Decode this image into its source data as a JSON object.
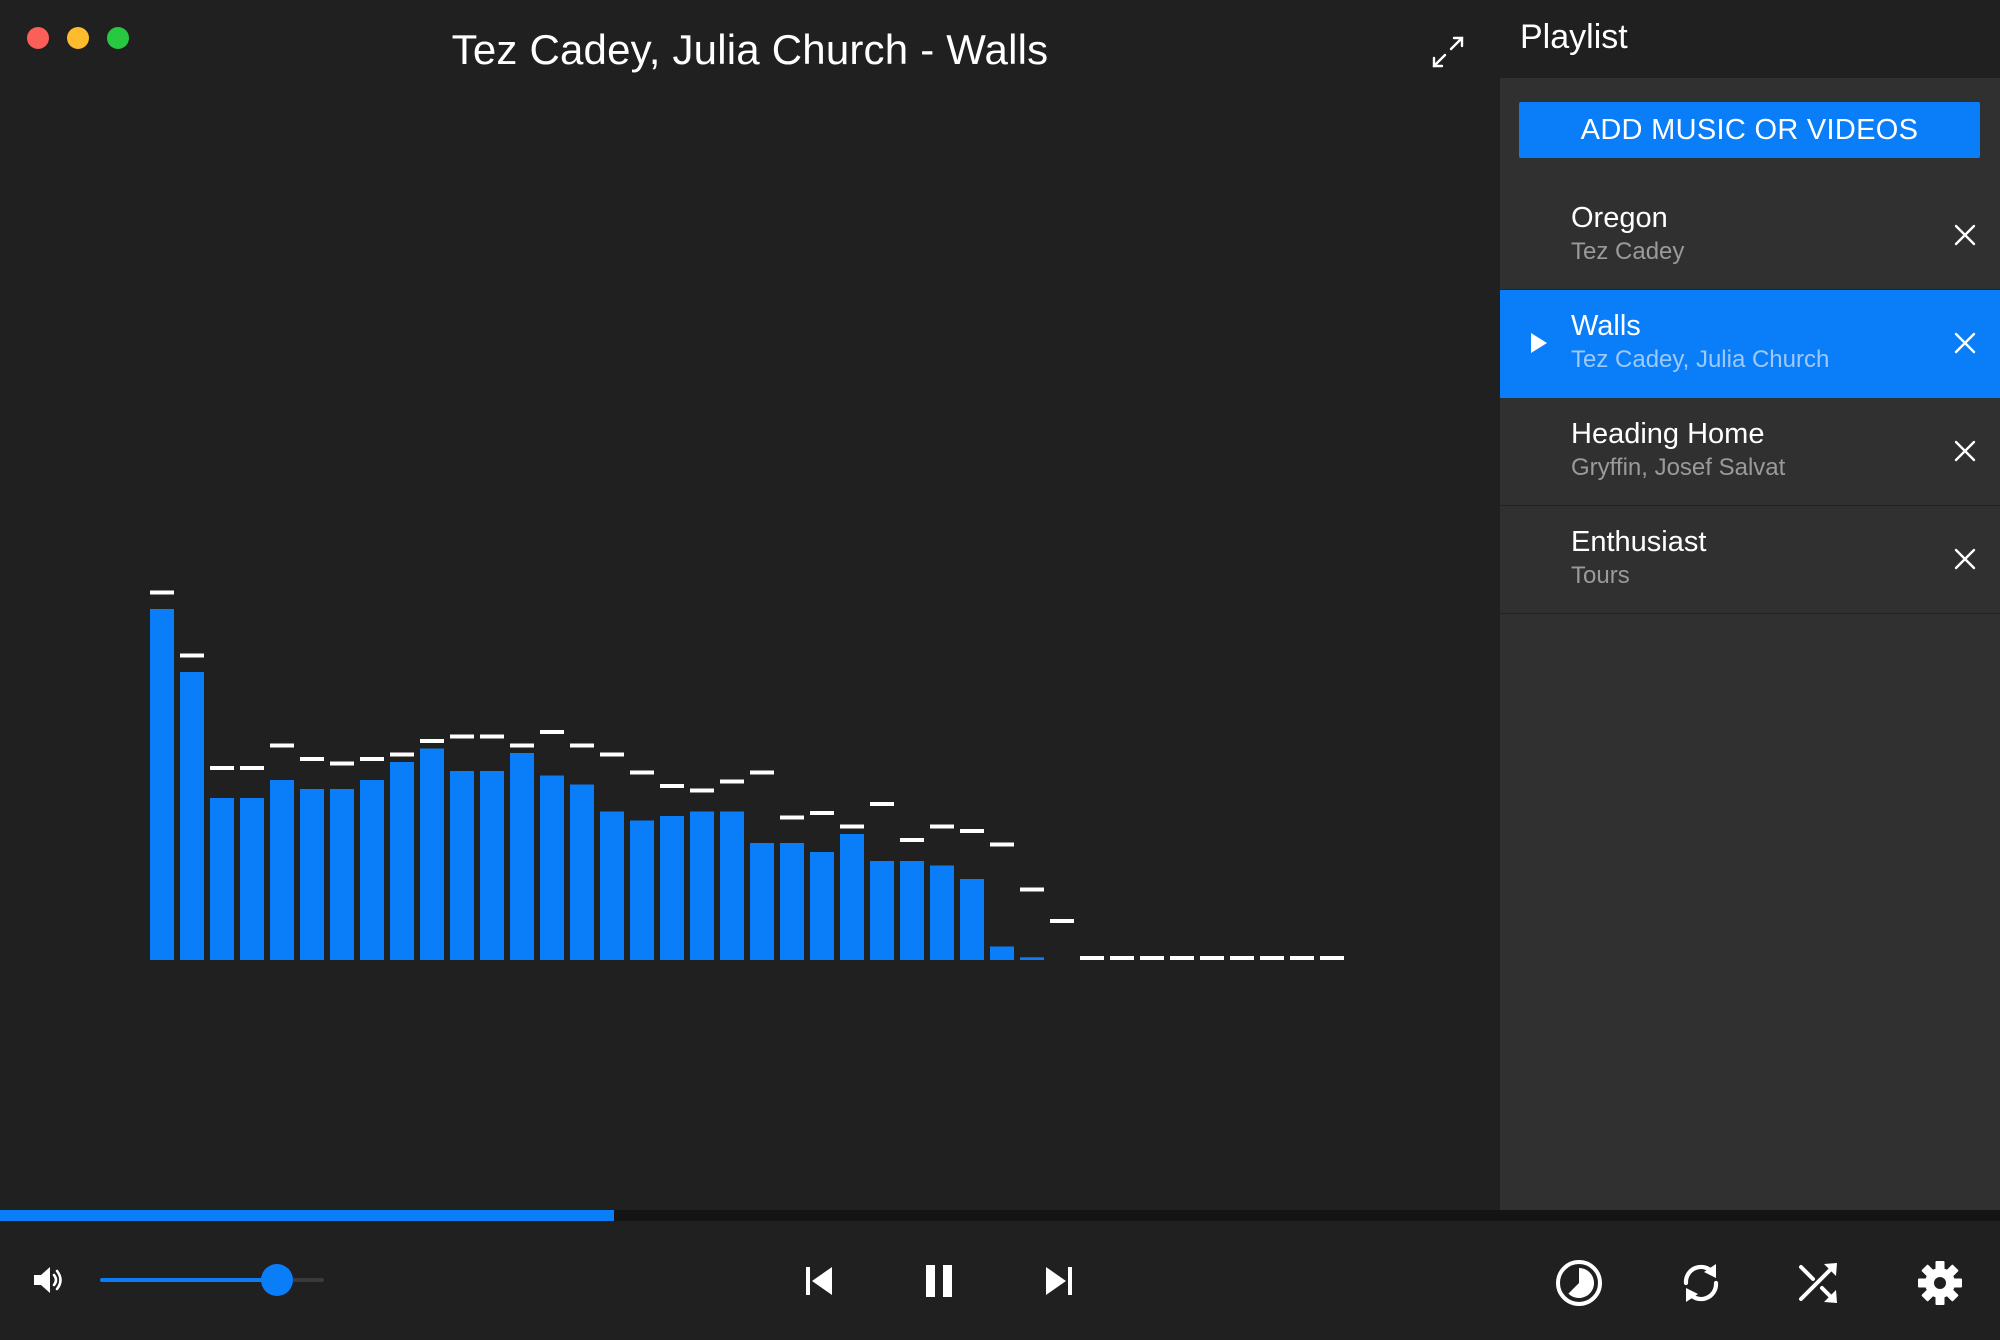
{
  "window": {
    "title": "Tez Cadey, Julia Church - Walls"
  },
  "playlist": {
    "title": "Playlist",
    "add_button_label": "ADD MUSIC OR VIDEOS",
    "items": [
      {
        "song": "Oregon",
        "artist": "Tez Cadey",
        "playing": false
      },
      {
        "song": "Walls",
        "artist": "Tez Cadey, Julia Church",
        "playing": true
      },
      {
        "song": "Heading Home",
        "artist": "Gryffin, Josef Salvat",
        "playing": false
      },
      {
        "song": "Enthusiast",
        "artist": "Tours",
        "playing": false
      }
    ]
  },
  "player": {
    "progress_fraction": 0.307,
    "volume_fraction": 0.79,
    "state": "playing"
  },
  "controls": {
    "volume_icon": "speaker-icon",
    "previous_icon": "skip-previous-icon",
    "pause_icon": "pause-icon",
    "next_icon": "skip-next-icon",
    "visualizer_icon": "visualizer-toggle-icon",
    "repeat_icon": "repeat-icon",
    "shuffle_icon": "shuffle-icon",
    "settings_icon": "gear-icon",
    "fullscreen_icon": "expand-icon"
  },
  "colors": {
    "accent": "#0a7df8",
    "background": "#202020",
    "sidebar": "#303030",
    "peak": "#ffffff"
  },
  "visualizer": {
    "levels": [
      0.78,
      0.64,
      0.36,
      0.36,
      0.4,
      0.38,
      0.38,
      0.4,
      0.44,
      0.47,
      0.42,
      0.42,
      0.46,
      0.41,
      0.39,
      0.33,
      0.31,
      0.32,
      0.33,
      0.33,
      0.26,
      0.26,
      0.24,
      0.28,
      0.22,
      0.22,
      0.21,
      0.18,
      0.03,
      0.006,
      0,
      0,
      0,
      0,
      0,
      0,
      0,
      0,
      0,
      0
    ],
    "peaks": [
      0.79,
      0.65,
      0.4,
      0.4,
      0.45,
      0.42,
      0.41,
      0.42,
      0.43,
      0.46,
      0.47,
      0.47,
      0.45,
      0.48,
      0.45,
      0.43,
      0.39,
      0.36,
      0.35,
      0.37,
      0.39,
      0.29,
      0.3,
      0.27,
      0.32,
      0.24,
      0.27,
      0.26,
      0.23,
      0.13,
      0.06,
      0,
      0,
      0,
      0,
      0,
      0,
      0,
      0,
      0
    ]
  }
}
